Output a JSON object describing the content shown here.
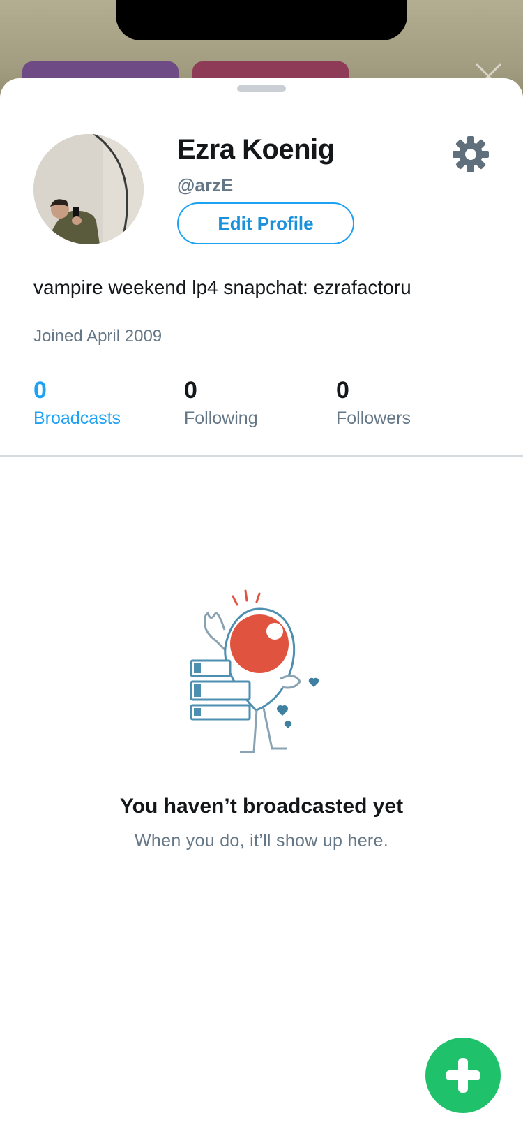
{
  "profile": {
    "name": "Ezra Koenig",
    "handle": "@arzE",
    "edit_label": "Edit Profile",
    "bio": "vampire weekend lp4 snapchat: ezrafactoru",
    "joined": "Joined April 2009"
  },
  "stats": [
    {
      "count": "0",
      "label": "Broadcasts",
      "active": true
    },
    {
      "count": "0",
      "label": "Following",
      "active": false
    },
    {
      "count": "0",
      "label": "Followers",
      "active": false
    }
  ],
  "empty_state": {
    "title": "You haven’t broadcasted yet",
    "subtitle": "When you do, it’ll show up here."
  },
  "icons": {
    "settings": "gear-icon",
    "new_broadcast": "plus-icon",
    "close": "close-icon"
  },
  "colors": {
    "accent": "#1da1f2",
    "fab": "#1fc16b",
    "muted": "#657786",
    "text": "#14171a",
    "illustration_red": "#e0533f",
    "illustration_blue": "#3f7fa0"
  }
}
